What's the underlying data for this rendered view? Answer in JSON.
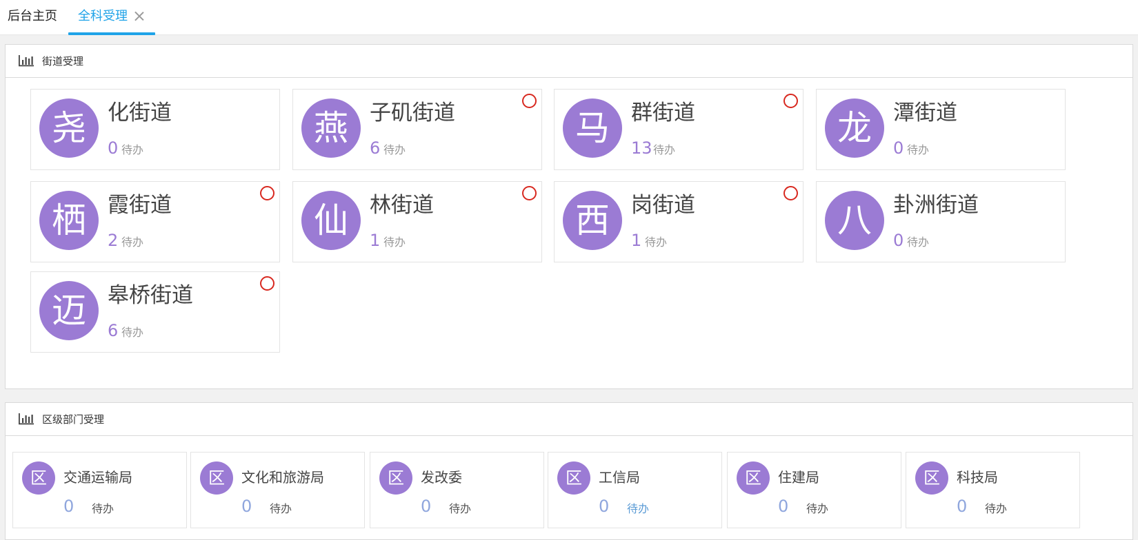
{
  "tabs": {
    "home_label": "后台主页",
    "active_label": "全科受理"
  },
  "street_panel": {
    "title": "街道受理",
    "cards": [
      {
        "avatar": "尧",
        "name": "化街道",
        "count": "0",
        "todo": "待办",
        "alert": false
      },
      {
        "avatar": "燕",
        "name": "子矶街道",
        "count": "6",
        "todo": "待办",
        "alert": true
      },
      {
        "avatar": "马",
        "name": "群街道",
        "count": "13",
        "todo": "待办",
        "alert": true
      },
      {
        "avatar": "龙",
        "name": "潭街道",
        "count": "0",
        "todo": "待办",
        "alert": false
      },
      {
        "avatar": "栖",
        "name": "霞街道",
        "count": "2",
        "todo": "待办",
        "alert": true
      },
      {
        "avatar": "仙",
        "name": "林街道",
        "count": "1",
        "todo": "待办",
        "alert": true
      },
      {
        "avatar": "西",
        "name": "岗街道",
        "count": "1",
        "todo": "待办",
        "alert": true
      },
      {
        "avatar": "八",
        "name": "卦洲街道",
        "count": "0",
        "todo": "待办",
        "alert": false
      },
      {
        "avatar": "迈",
        "name": "皋桥街道",
        "count": "6",
        "todo": "待办",
        "alert": true
      }
    ]
  },
  "dept_panel": {
    "title": "区级部门受理",
    "cards": [
      {
        "avatar": "区",
        "name": "交通运输局",
        "count": "0",
        "todo": "待办"
      },
      {
        "avatar": "区",
        "name": "文化和旅游局",
        "count": "0",
        "todo": "待办"
      },
      {
        "avatar": "区",
        "name": "发改委",
        "count": "0",
        "todo": "待办"
      },
      {
        "avatar": "区",
        "name": "工信局",
        "count": "0",
        "todo": "待办"
      },
      {
        "avatar": "区",
        "name": "住建局",
        "count": "0",
        "todo": "待办"
      },
      {
        "avatar": "区",
        "name": "科技局",
        "count": "0",
        "todo": "待办"
      }
    ]
  },
  "colors": {
    "accent": "#1fa3e8",
    "avatar": "#9b7bd4",
    "alert_ring": "#d8281f",
    "todo_link": "#5b9bd5"
  },
  "icons": {
    "panel_header": "bar-chart-icon",
    "tab_close": "close-icon",
    "alert": "alert-ring-icon"
  }
}
